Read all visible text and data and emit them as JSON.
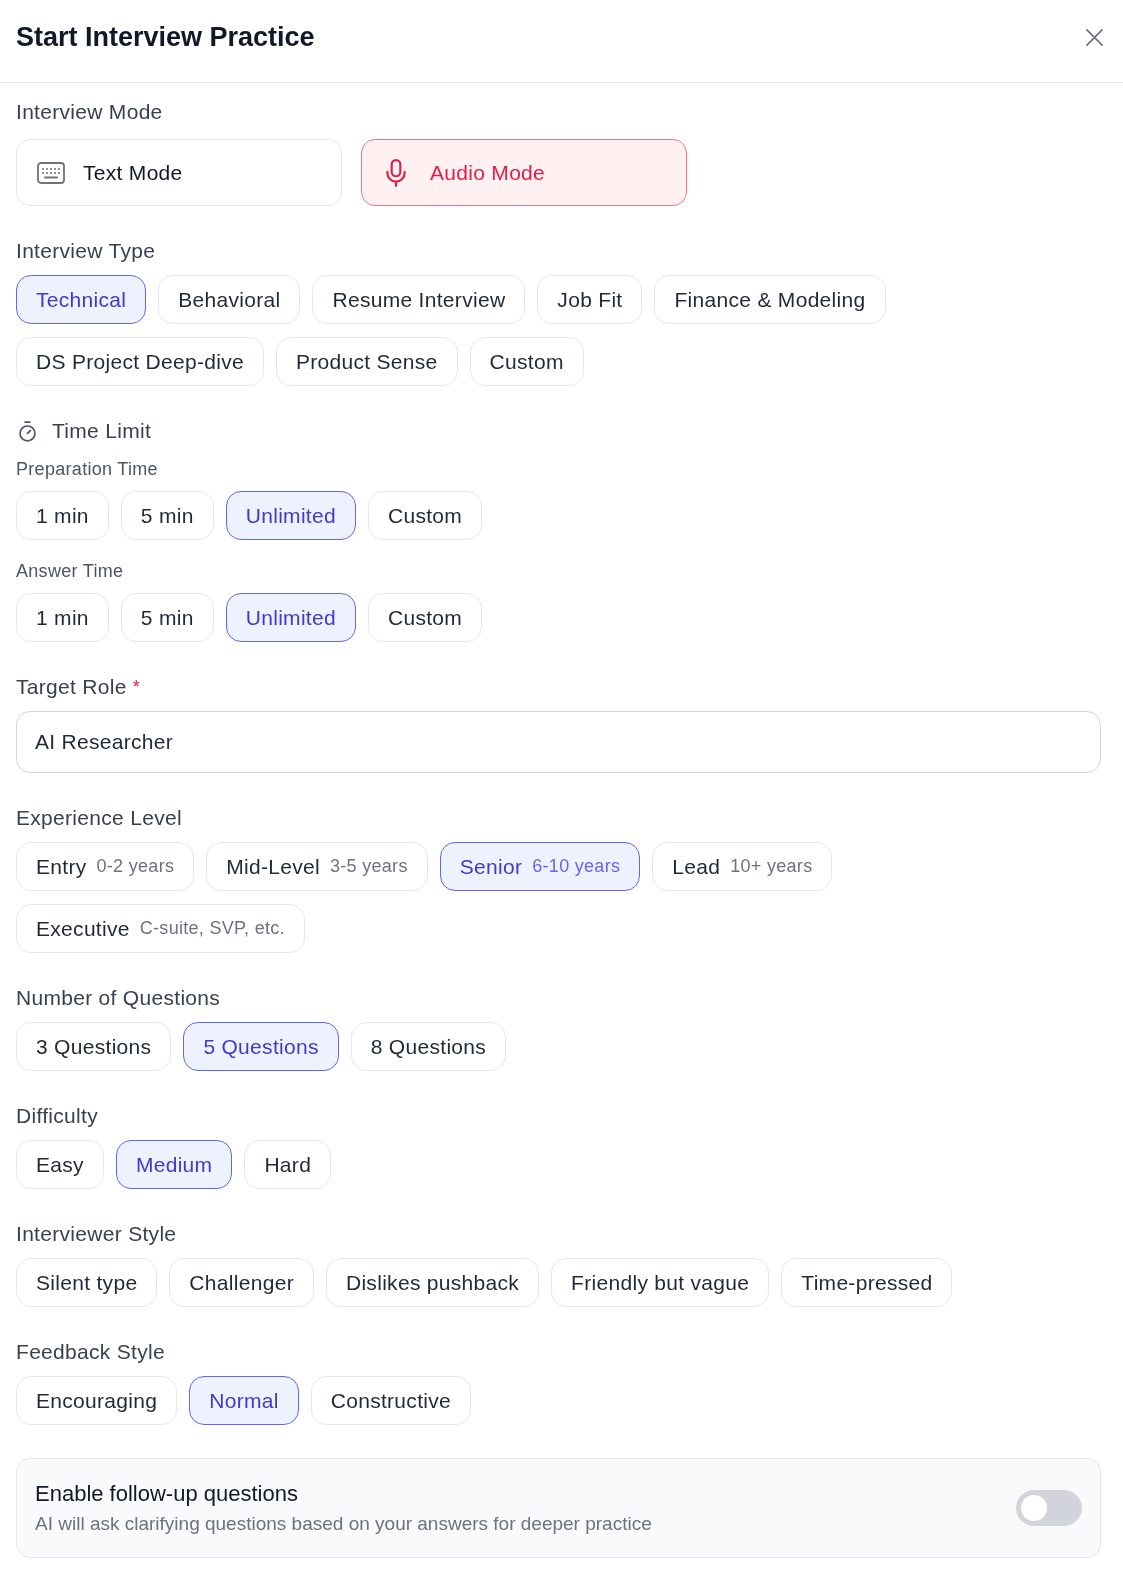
{
  "dialog": {
    "title": "Start Interview Practice"
  },
  "sections": [
    {
      "kind": "modes",
      "label": "Interview Mode",
      "options": [
        {
          "kind": "text",
          "label": "Text Mode",
          "selected": false
        },
        {
          "kind": "audio",
          "label": "Audio Mode",
          "selected": true
        }
      ]
    },
    {
      "kind": "chips",
      "label": "Interview Type",
      "options": [
        {
          "label": "Technical",
          "selected": true
        },
        {
          "label": "Behavioral",
          "selected": false
        },
        {
          "label": "Resume Interview",
          "selected": false
        },
        {
          "label": "Job Fit",
          "selected": false
        },
        {
          "label": "Finance & Modeling",
          "selected": false
        },
        {
          "label": "DS Project Deep-dive",
          "selected": false
        },
        {
          "label": "Product Sense",
          "selected": false
        },
        {
          "label": "Custom",
          "selected": false
        }
      ]
    },
    {
      "kind": "time",
      "label": "Time Limit",
      "groups": [
        {
          "label": "Preparation Time",
          "options": [
            {
              "label": "1 min",
              "selected": false
            },
            {
              "label": "5 min",
              "selected": false
            },
            {
              "label": "Unlimited",
              "selected": true
            },
            {
              "label": "Custom",
              "selected": false
            }
          ]
        },
        {
          "label": "Answer Time",
          "options": [
            {
              "label": "1 min",
              "selected": false
            },
            {
              "label": "5 min",
              "selected": false
            },
            {
              "label": "Unlimited",
              "selected": true
            },
            {
              "label": "Custom",
              "selected": false
            }
          ]
        }
      ]
    },
    {
      "kind": "field",
      "label": "Target Role",
      "required_mark": "*",
      "value": "AI Researcher"
    },
    {
      "kind": "chips",
      "label": "Experience Level",
      "options": [
        {
          "label": "Entry",
          "detail": "0-2 years",
          "selected": false
        },
        {
          "label": "Mid-Level",
          "detail": "3-5 years",
          "selected": false
        },
        {
          "label": "Senior",
          "detail": "6-10 years",
          "selected": true
        },
        {
          "label": "Lead",
          "detail": "10+ years",
          "selected": false
        },
        {
          "label": "Executive",
          "detail": "C-suite, SVP, etc.",
          "selected": false
        }
      ]
    },
    {
      "kind": "chips",
      "label": "Number of Questions",
      "options": [
        {
          "label": "3 Questions",
          "selected": false
        },
        {
          "label": "5 Questions",
          "selected": true
        },
        {
          "label": "8 Questions",
          "selected": false
        }
      ]
    },
    {
      "kind": "chips",
      "label": "Difficulty",
      "options": [
        {
          "label": "Easy",
          "selected": false
        },
        {
          "label": "Medium",
          "selected": true
        },
        {
          "label": "Hard",
          "selected": false
        }
      ]
    },
    {
      "kind": "chips",
      "label": "Interviewer Style",
      "options": [
        {
          "label": "Silent type",
          "selected": false
        },
        {
          "label": "Challenger",
          "selected": false
        },
        {
          "label": "Dislikes pushback",
          "selected": false
        },
        {
          "label": "Friendly but vague",
          "selected": false
        },
        {
          "label": "Time-pressed",
          "selected": false
        }
      ]
    },
    {
      "kind": "chips",
      "label": "Feedback Style",
      "options": [
        {
          "label": "Encouraging",
          "selected": false
        },
        {
          "label": "Normal",
          "selected": true
        },
        {
          "label": "Constructive",
          "selected": false
        }
      ]
    },
    {
      "kind": "toggle",
      "title": "Enable follow-up questions",
      "description": "AI will ask clarifying questions based on your answers for deeper practice",
      "on": false
    }
  ]
}
